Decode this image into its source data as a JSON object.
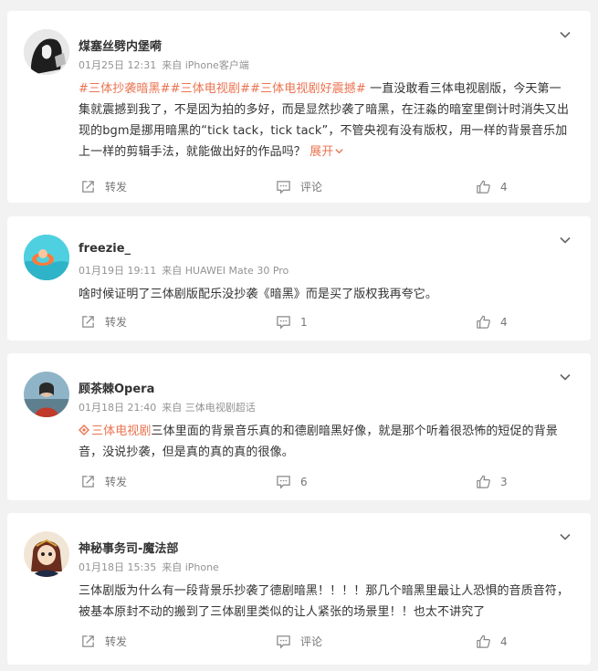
{
  "posts": [
    {
      "user": "煤塞丝劈内堡嗬",
      "date": "01月25日 12:31",
      "source": "来自 iPhone客户端",
      "tags": [
        "#三体抄袭暗黑#",
        "#三体电视剧#",
        "#三体电视剧好震撼#"
      ],
      "text": " 一直没敢看三体电视剧版，今天第一集就震撼到我了，不是因为拍的多好，而是显然抄袭了暗黑，在汪淼的暗室里倒计时消失又出现的bgm是挪用暗黑的“tick tack，tick tack”，不管央视有没有版权，用一样的背景音乐加上一样的剪辑手法，就能做出好的作品吗？ ",
      "expand": "展开",
      "share": "转发",
      "comment": "评论",
      "likes": "4"
    },
    {
      "user": "freezie_",
      "date": "01月19日 19:11",
      "source": "来自 HUAWEI Mate 30 Pro",
      "text": "啥时候证明了三体剧版配乐没抄袭《暗黑》而是买了版权我再夸它。",
      "share": "转发",
      "comment": "1",
      "likes": "4"
    },
    {
      "user": "顾茶棘Opera",
      "date": "01月18日 21:40",
      "source": "来自 三体电视剧超话",
      "topic": "三体电视剧",
      "text": "三体里面的背景音乐真的和德剧暗黑好像，就是那个听着很恐怖的短促的背景音，没说抄袭，但是真的真的真的很像。",
      "share": "转发",
      "comment": "6",
      "likes": "3"
    },
    {
      "user": "神秘事务司-魔法部",
      "date": "01月18日 15:35",
      "source": "来自 iPhone",
      "text": "三体剧版为什么有一段背景乐抄袭了德剧暗黑！！！！那几个暗黑里最让人恐惧的音质音符，被基本原封不动的搬到了三体剧里类似的让人紧张的场景里！！也太不讲究了",
      "share": "转发",
      "comment": "评论",
      "likes": "4"
    }
  ]
}
